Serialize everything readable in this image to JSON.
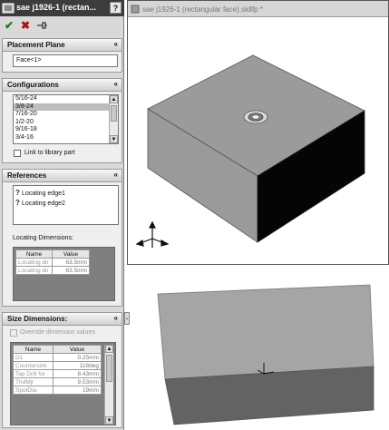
{
  "property_manager": {
    "title": "sae j1926-1 (rectan...",
    "help": "?",
    "placement_plane": {
      "header": "Placement Plane",
      "value": "Face<1>"
    },
    "configurations": {
      "header": "Configurations",
      "items": [
        "5/16-24",
        "3/8-24",
        "7/16-20",
        "1/2-20",
        "9/16-18",
        "3/4-16"
      ],
      "selected_index": 1,
      "link_label": "Link to library part"
    },
    "references": {
      "header": "References",
      "items": [
        "Locating edge1",
        "Locating edge2"
      ],
      "locating_dimensions_label": "Locating Dimensions:",
      "columns": [
        "Name",
        "Value"
      ],
      "rows": [
        {
          "name": "Locating dir",
          "value": "63.5mm"
        },
        {
          "name": "Locating dir",
          "value": "63.5mm"
        }
      ]
    },
    "size_dimensions": {
      "header": "Size Dimensions:",
      "override_label": "Override dimension values",
      "columns": [
        "Name",
        "Value"
      ],
      "rows": [
        {
          "name": "D1",
          "value": "0.25mm"
        },
        {
          "name": "Countersink",
          "value": "118deg"
        },
        {
          "name": "Tap Drill for",
          "value": "8.43mm"
        },
        {
          "name": "ThdMjr",
          "value": "9.53mm"
        },
        {
          "name": "SpotDia",
          "value": "19mm"
        }
      ]
    }
  },
  "viewport": {
    "title": "sae j1926-1 (rectangular face).sldlfp *"
  }
}
